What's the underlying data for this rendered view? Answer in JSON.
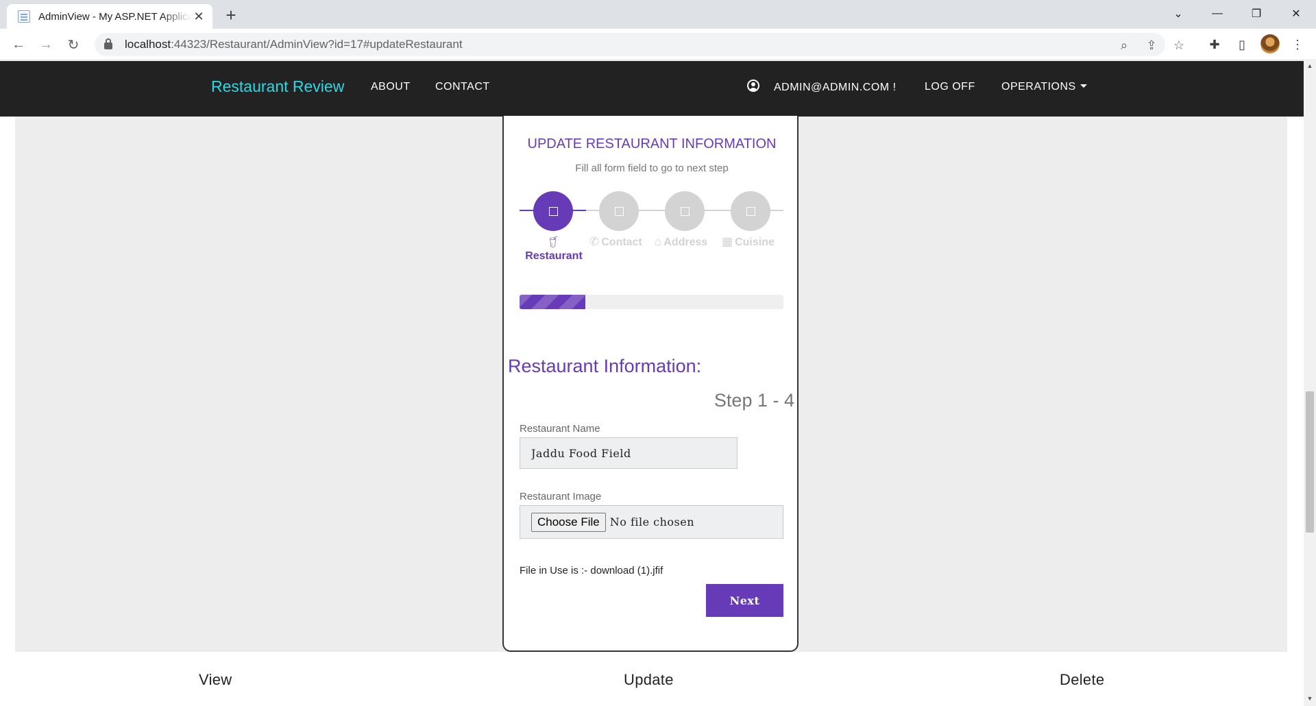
{
  "browser": {
    "tab_title": "AdminView - My ASP.NET Application",
    "url_host": "localhost",
    "url_path": ":44323/Restaurant/AdminView?id=17#updateRestaurant"
  },
  "nav": {
    "brand": "Restaurant Review",
    "about": "ABOUT",
    "contact": "CONTACT",
    "user": "ADMIN@ADMIN.COM !",
    "logoff": "LOG OFF",
    "operations": "OPERATIONS"
  },
  "form": {
    "title": "UPDATE RESTAURANT INFORMATION",
    "subtitle": "Fill all form field to go to next step",
    "steps": [
      {
        "label": "Restaurant",
        "icon": "drink-icon"
      },
      {
        "label": "Contact",
        "icon": "phone-icon"
      },
      {
        "label": "Address",
        "icon": "home-icon"
      },
      {
        "label": "Cuisine",
        "icon": "table-icon"
      }
    ],
    "progress_fraction": 0.25,
    "section_title": "Restaurant Information:",
    "step_count": "Step 1 - 4",
    "name_label": "Restaurant Name",
    "name_value": "Jaddu Food Field",
    "image_label": "Restaurant Image",
    "file_button": "Choose File",
    "file_status": "No file chosen",
    "file_in_use": "File in Use is :- download (1).jfif",
    "next_label": "Next"
  },
  "footer": {
    "view": "View",
    "update": "Update",
    "delete": "Delete"
  },
  "colors": {
    "accent": "#673ab7",
    "brand": "#2bd9e5",
    "navbar": "#222222"
  }
}
